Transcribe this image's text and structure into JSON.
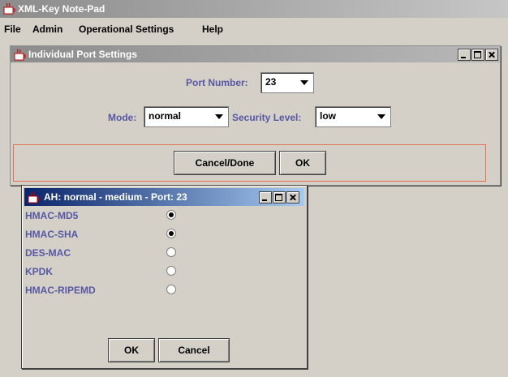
{
  "app": {
    "title": "XML-Key Note-Pad",
    "menu": [
      "File",
      "Admin",
      "Operational Settings",
      "Help"
    ]
  },
  "port_settings": {
    "title": "Individual Port Settings",
    "port_label": "Port Number:",
    "port_value": "23",
    "mode_label": "Mode:",
    "mode_value": "normal",
    "security_label": "Security Level:",
    "security_value": "low",
    "cancel_label": "Cancel/Done",
    "ok_label": "OK"
  },
  "ah_window": {
    "title": "AH: normal - medium - Port: 23",
    "algorithms": [
      {
        "label": "HMAC-MD5",
        "selected": true
      },
      {
        "label": "HMAC-SHA",
        "selected": true
      },
      {
        "label": "DES-MAC",
        "selected": false
      },
      {
        "label": "KPDK",
        "selected": false
      },
      {
        "label": "HMAC-RIPEMD",
        "selected": false
      }
    ],
    "ok_label": "OK",
    "cancel_label": "Cancel"
  },
  "colors": {
    "label_text": "#5757a3",
    "active_title": "#0a246a",
    "inactive_title": "#8c8c8c",
    "panel_border": "#e07050"
  },
  "icons": [
    "java-cup-icon",
    "minimize-icon",
    "maximize-icon",
    "close-icon",
    "dropdown-arrow-icon"
  ]
}
